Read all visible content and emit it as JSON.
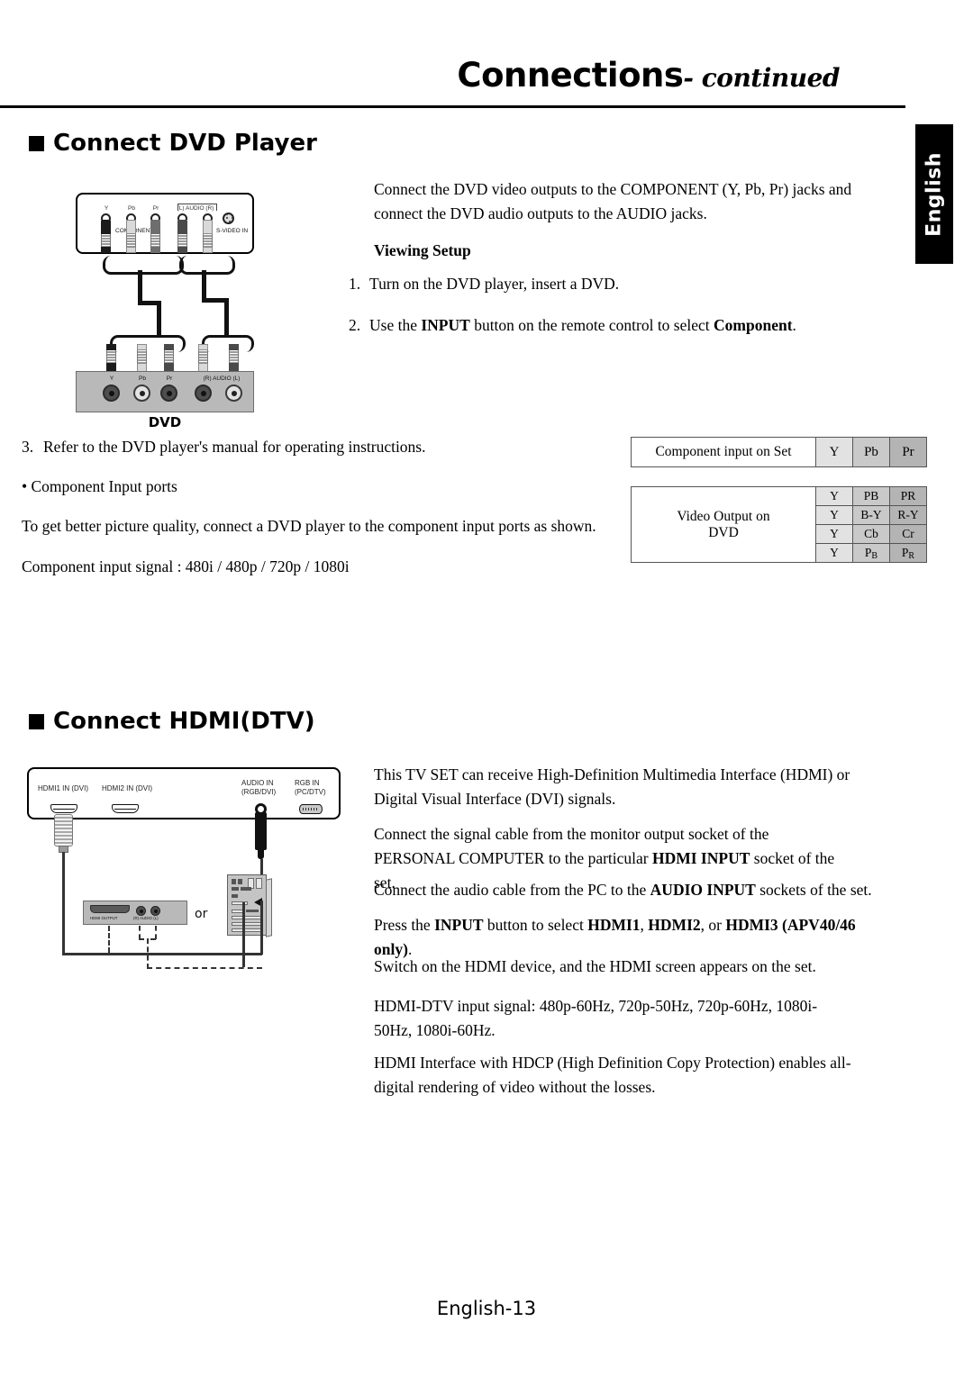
{
  "header": {
    "title": "Connections",
    "subtitle": "- continued"
  },
  "side_tab": {
    "label": "English"
  },
  "sections": {
    "dvd": {
      "heading": "Connect DVD Player"
    },
    "hdmi": {
      "heading": "Connect HDMI(DTV)"
    }
  },
  "dvd_text": {
    "intro": "Connect the DVD video outputs to the COMPONENT (Y, Pb, Pr) jacks and connect the DVD audio outputs to the AUDIO jacks.",
    "viewing_setup_heading": "Viewing Setup",
    "step1_num": "1.",
    "step1": "Turn on the DVD player, insert a DVD.",
    "step2_num": "2.",
    "step2_a": "Use the ",
    "step2_input": "INPUT",
    "step2_b": " button on the remote control to select ",
    "step2_component": "Component",
    "step2_c": ".",
    "step3_num": "3.",
    "step3": "Refer to the DVD player's manual for operating instructions.",
    "bullet_ports": "• Component Input ports",
    "quality": "To get better picture quality, connect a DVD player to the component input ports as shown.",
    "signal": "Component input signal : 480i / 480p / 720p / 1080i"
  },
  "dvd_diagram": {
    "tv_labels": {
      "y": "Y",
      "pb": "Pb",
      "pr": "Pr",
      "audio": "(L) AUDIO (R)",
      "component_in": "COMPONENT IN",
      "svideo_in": "S-VIDEO IN"
    },
    "dvd_labels": {
      "y": "Y",
      "pb": "Pb",
      "pr": "Pr",
      "audio": "(R) AUDIO (L)"
    },
    "caption": "DVD"
  },
  "tables": {
    "set": {
      "label": "Component input on Set",
      "values": [
        "Y",
        "Pb",
        "Pr"
      ]
    },
    "dvd": {
      "label_line1": "Video Output on",
      "label_line2": "DVD",
      "rows": [
        [
          "Y",
          "PB",
          "PR"
        ],
        [
          "Y",
          "B-Y",
          "R-Y"
        ],
        [
          "Y",
          "Cb",
          "Cr"
        ],
        [
          "Y",
          "PB",
          "PR"
        ]
      ]
    }
  },
  "hdmi_diagram": {
    "panel_labels": {
      "hdmi1": "HDMI1 IN (DVI)",
      "hdmi2": "HDMI2 IN (DVI)",
      "audio_in_l1": "AUDIO IN",
      "audio_in_l2": "(RGB/DVI)",
      "rgb_in_l1": "RGB IN",
      "rgb_in_l2": "(PC/DTV)"
    },
    "source_labels": {
      "hdmi_output": "HDMI OUTPUT",
      "audio": "(R) AUDIO (L)"
    },
    "or": "or"
  },
  "hdmi_text": {
    "p1": "This TV SET can receive High-Definition Multimedia Interface (HDMI) or Digital Visual Interface (DVI) signals.",
    "p2_a": "Connect the signal cable from the monitor output socket of the PERSONAL COMPUTER to the particular ",
    "p2_b": "HDMI INPUT",
    "p2_c": " socket of the set.",
    "p3_a": "Connect the audio cable from the PC to the ",
    "p3_b": "AUDIO INPUT",
    "p3_c": " sockets of the set.",
    "p4_a": "Press the ",
    "p4_input": "INPUT",
    "p4_b": " button to select ",
    "p4_h1": "HDMI1",
    "p4_c": ", ",
    "p4_h2": "HDMI2",
    "p4_d": ", or ",
    "p4_h3": "HDMI3 (APV40/46 only)",
    "p4_e": ".",
    "p5": "Switch on the HDMI device, and the HDMI screen appears on the set.",
    "p6": "HDMI-DTV input signal: 480p-60Hz, 720p-50Hz, 720p-60Hz, 1080i-50Hz, 1080i-60Hz.",
    "p7": "HDMI Interface with HDCP (High Definition Copy Protection) enables all-digital rendering of video without the losses."
  },
  "footer": {
    "page": "English-13"
  }
}
